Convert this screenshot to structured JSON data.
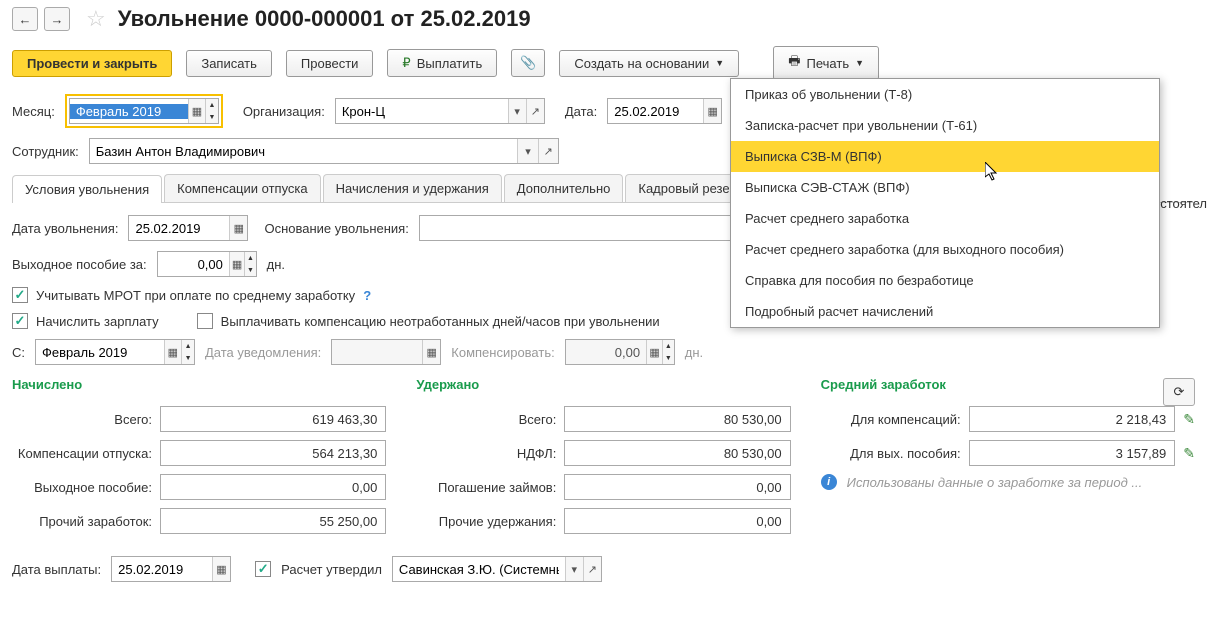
{
  "header": {
    "title": "Увольнение 0000-000001 от 25.02.2019"
  },
  "toolbar": {
    "post_and_close": "Провести и закрыть",
    "save": "Записать",
    "post": "Провести",
    "pay": "Выплатить",
    "create_based": "Создать на основании",
    "print": "Печать"
  },
  "fields": {
    "month_label": "Месяц:",
    "month_value": "Февраль 2019",
    "org_label": "Организация:",
    "org_value": "Крон-Ц",
    "date_label": "Дата:",
    "date_value": "25.02.2019",
    "employee_label": "Сотрудник:",
    "employee_value": "Базин Антон Владимирович"
  },
  "tabs": [
    "Условия увольнения",
    "Компенсации отпуска",
    "Начисления и удержания",
    "Дополнительно",
    "Кадровый резерв"
  ],
  "conditions": {
    "dismissal_date_label": "Дата увольнения:",
    "dismissal_date_value": "25.02.2019",
    "basis_label": "Основание увольнения:",
    "basis_value": "",
    "right_cut": "обстоятел",
    "severance_label": "Выходное пособие за:",
    "severance_value": "0,00",
    "days_label": "дн.",
    "mrot_label": "Учитывать МРОТ при оплате по среднему заработку",
    "accrue_salary_label": "Начислить зарплату",
    "pay_compensation_label": "Выплачивать компенсацию неотработанных дней/часов при увольнении",
    "from_label": "С:",
    "from_value": "Февраль 2019",
    "notif_date_label": "Дата уведомления:",
    "notif_date_value": "",
    "compensate_label": "Компенсировать:",
    "compensate_value": "0,00"
  },
  "totals": {
    "accrued_header": "Начислено",
    "withheld_header": "Удержано",
    "avg_header": "Средний заработок",
    "total_label": "Всего:",
    "vacation_comp_label": "Компенсации отпуска:",
    "severance_label": "Выходное пособие:",
    "other_income_label": "Прочий заработок:",
    "ndfl_label": "НДФЛ:",
    "loan_repay_label": "Погашение займов:",
    "other_withhold_label": "Прочие удержания:",
    "for_comp_label": "Для компенсаций:",
    "for_sev_label": "Для вых. пособия:",
    "accrued_total": "619 463,30",
    "vacation_comp": "564 213,30",
    "severance": "0,00",
    "other_income": "55 250,00",
    "withheld_total": "80 530,00",
    "ndfl": "80 530,00",
    "loan_repay": "0,00",
    "other_withhold": "0,00",
    "for_comp": "2 218,43",
    "for_sev": "3 157,89",
    "info_text": "Использованы данные о заработке за период ..."
  },
  "footer": {
    "pay_date_label": "Дата выплаты:",
    "pay_date_value": "25.02.2019",
    "approved_label": "Расчет утвердил",
    "approved_value": "Савинская З.Ю. (Системный п"
  },
  "print_menu": {
    "items": [
      "Приказ об увольнении (Т-8)",
      "Записка-расчет при увольнении (Т-61)",
      "Выписка СЗВ-М (ВПФ)",
      "Выписка СЭВ-СТАЖ (ВПФ)",
      "Расчет среднего заработка",
      "Расчет среднего заработка (для выходного пособия)",
      "Справка для пособия по безработице",
      "Подробный расчет начислений"
    ]
  }
}
